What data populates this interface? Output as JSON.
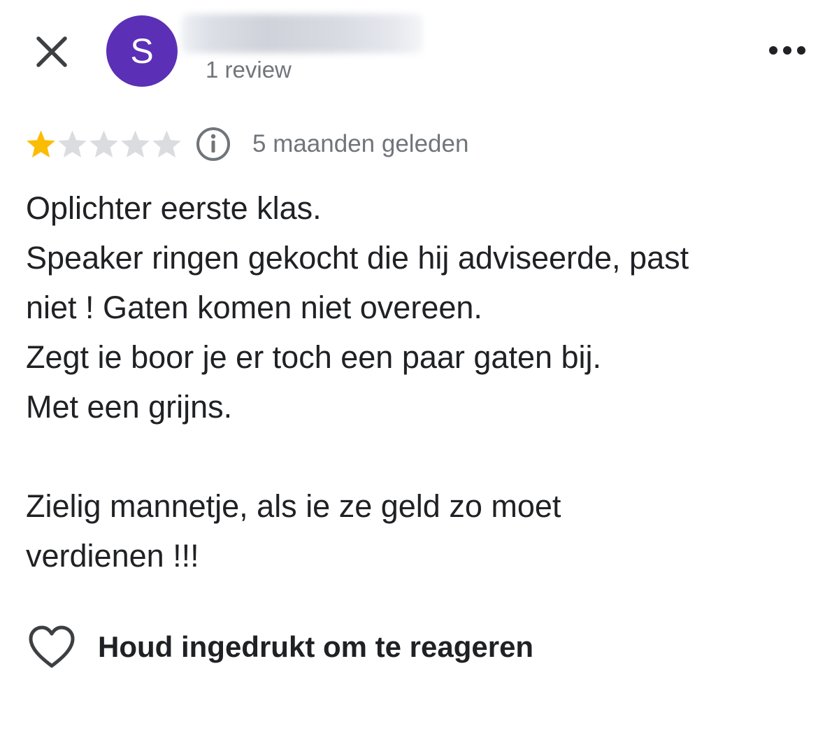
{
  "header": {
    "close_icon": "close-icon",
    "avatar_initial": "S",
    "avatar_color": "#5b2fb6",
    "review_count": "1 review",
    "more_icon": "more-horizontal-icon"
  },
  "rating": {
    "stars_filled": 1,
    "stars_total": 5,
    "star_color": "#fbbc04",
    "star_empty_color": "#dadce0",
    "info_icon": "info-icon",
    "date": "5 maanden geleden"
  },
  "review": {
    "lines": [
      "Oplichter eerste klas.",
      "Speaker ringen gekocht die hij adviseerde, past",
      "niet ! Gaten komen niet overeen.",
      "Zegt ie boor je er toch een paar gaten bij.",
      "Met een grijns.",
      "",
      "Zielig mannetje, als ie ze geld zo moet",
      "verdienen !!!"
    ]
  },
  "reaction": {
    "icon": "heart-icon",
    "label": "Houd ingedrukt om te reageren"
  }
}
